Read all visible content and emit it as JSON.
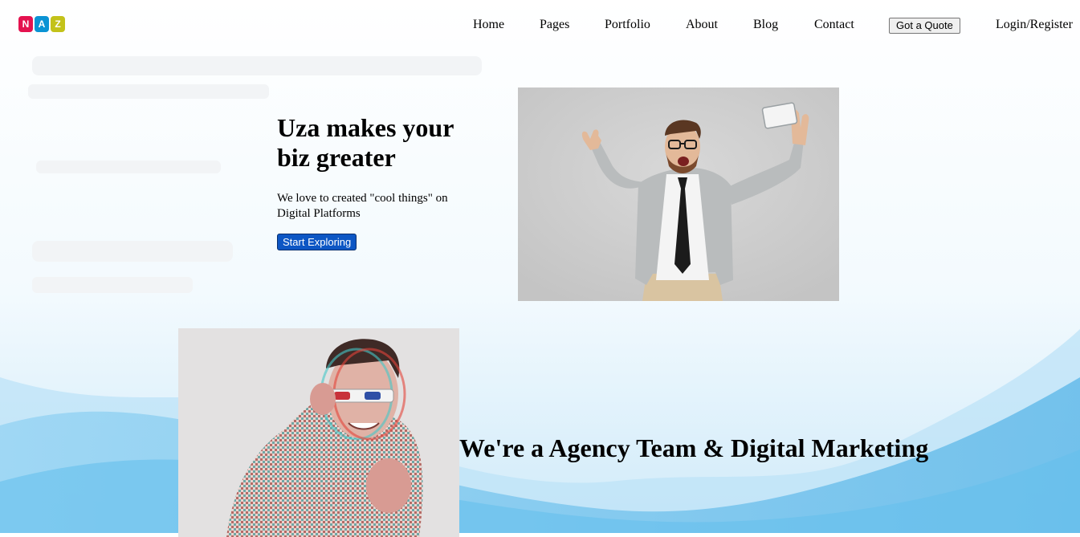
{
  "header": {
    "logo_letters": [
      "N",
      "A",
      "Z"
    ],
    "logo_colors": [
      "#e4124f",
      "#0a93d4",
      "#c3c21a"
    ],
    "nav": [
      "Home",
      "Pages",
      "Portfolio",
      "About",
      "Blog",
      "Contact"
    ],
    "quote_button": "Got a Quote",
    "login": "Login/Register"
  },
  "hero": {
    "title": "Uza makes your biz greater",
    "subtitle": "We love to created \"cool things\" on Digital Platforms",
    "cta": "Start Exploring"
  },
  "section2": {
    "title": "We're a Agency Team & Digital Marketing"
  },
  "colors": {
    "cta_background": "#0d56c4",
    "wave_blue": "#62bdeb"
  }
}
